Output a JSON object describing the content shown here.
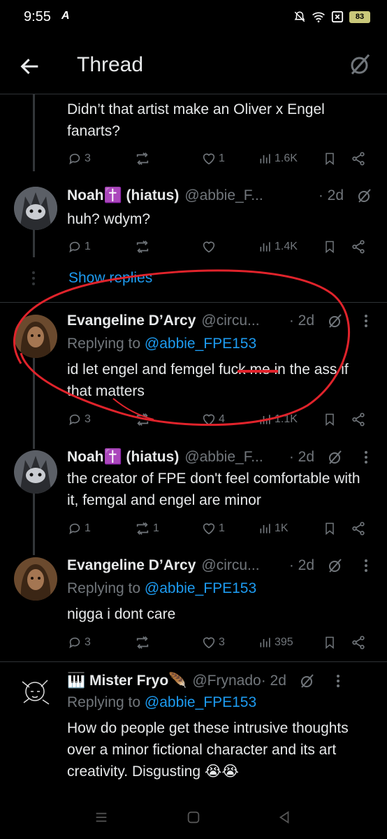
{
  "status_bar": {
    "time": "9:55",
    "app_indicator": "A",
    "battery": "83"
  },
  "header": {
    "title": "Thread",
    "back_icon": "arrow-left-icon",
    "grok_icon": "grok-icon"
  },
  "posts": [
    {
      "text": "Didn’t that artist make an Oliver x Engel fanarts?",
      "replies": "3",
      "reposts": "",
      "likes": "1",
      "views": "1.6K"
    },
    {
      "name": "Noah✝️ (hiatus)",
      "handle": "@abbie_F...",
      "time": "· 2d",
      "text": "huh? wdym?",
      "replies": "1",
      "reposts": "",
      "likes": "",
      "views": "1.4K"
    },
    {
      "name": "Evangeline D’Arcy",
      "handle": "@circu...",
      "time": "· 2d",
      "replying_label": "Replying to ",
      "replying_to": "@abbie_FPE153",
      "text": "id let engel and femgel fuck me in the ass if that matters",
      "replies": "3",
      "reposts": "",
      "likes": "4",
      "views": "1.1K"
    },
    {
      "name": "Noah✝️ (hiatus)",
      "handle": "@abbie_F...",
      "time": "· 2d",
      "text": "the creator of FPE don't feel comfortable with it, femgal and engel are minor",
      "replies": "1",
      "reposts": "1",
      "likes": "1",
      "views": "1K"
    },
    {
      "name": "Evangeline D’Arcy",
      "handle": "@circu...",
      "time": "· 2d",
      "replying_label": "Replying to ",
      "replying_to": "@abbie_FPE153",
      "text": "nigga i dont care",
      "replies": "3",
      "reposts": "",
      "likes": "3",
      "views": "395"
    },
    {
      "name": "🎹 Mister Fryo🪶",
      "handle": "@Frynado",
      "time": "· 2d",
      "replying_label": "Replying to ",
      "replying_to": "@abbie_FPE153",
      "text": "How do people get these intrusive thoughts over a minor fictional character and its art creativity. Disgusting 😭😭"
    }
  ],
  "show_replies": "Show replies",
  "colors": {
    "background": "#000000",
    "text": "#e7e9ea",
    "muted": "#71767b",
    "link": "#1d9bf0",
    "annotation": "#e0232b"
  }
}
